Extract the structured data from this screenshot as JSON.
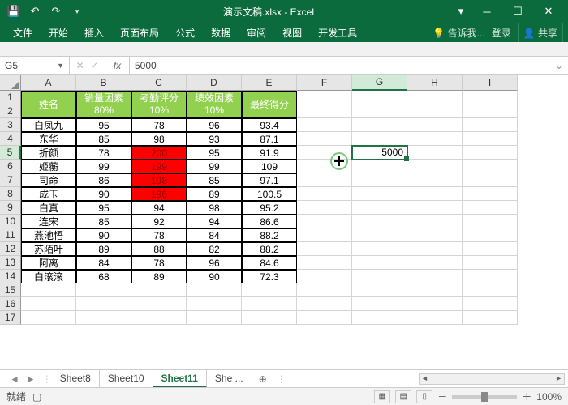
{
  "title": "演示文稿.xlsx - Excel",
  "ribbon": {
    "tabs": [
      "文件",
      "开始",
      "插入",
      "页面布局",
      "公式",
      "数据",
      "审阅",
      "视图",
      "开发工具"
    ],
    "tell": "告诉我...",
    "signin": "登录",
    "share": "共享"
  },
  "namebox": "G5",
  "formula": "5000",
  "columns": [
    "A",
    "B",
    "C",
    "D",
    "E",
    "F",
    "G",
    "H",
    "I"
  ],
  "row_numbers": [
    1,
    2,
    3,
    4,
    5,
    6,
    7,
    8,
    9,
    10,
    11,
    12,
    13,
    14,
    15,
    16,
    17
  ],
  "headers": {
    "name": "姓名",
    "col_b": "销量因素",
    "col_b_sub": "80%",
    "col_c": "考勤评分",
    "col_c_sub": "10%",
    "col_d": "绩效因素",
    "col_d_sub": "10%",
    "col_e": "最终得分"
  },
  "rows": [
    {
      "name": "白凤九",
      "b": 95,
      "c": 78,
      "d": 96,
      "e": 93.4,
      "red": false
    },
    {
      "name": "东华",
      "b": 85,
      "c": 98,
      "d": 93,
      "e": 87.1,
      "red": false
    },
    {
      "name": "折颜",
      "b": 78,
      "c": 200,
      "d": 95,
      "e": 91.9,
      "red": true
    },
    {
      "name": "姬蘅",
      "b": 99,
      "c": 199,
      "d": 99,
      "e": 109,
      "red": true
    },
    {
      "name": "司命",
      "b": 86,
      "c": 198,
      "d": 85,
      "e": 97.1,
      "red": true
    },
    {
      "name": "成玉",
      "b": 90,
      "c": 196,
      "d": 89,
      "e": 100.5,
      "red": true
    },
    {
      "name": "白真",
      "b": 95,
      "c": 94,
      "d": 98,
      "e": 95.2,
      "red": false
    },
    {
      "name": "连宋",
      "b": 85,
      "c": 92,
      "d": 94,
      "e": 86.6,
      "red": false
    },
    {
      "name": "燕池悟",
      "b": 90,
      "c": 78,
      "d": 84,
      "e": 88.2,
      "red": false
    },
    {
      "name": "苏陌叶",
      "b": 89,
      "c": 88,
      "d": 82,
      "e": 88.2,
      "red": false
    },
    {
      "name": "阿离",
      "b": 84,
      "c": 78,
      "d": 96,
      "e": 84.6,
      "red": false
    },
    {
      "name": "白滚滚",
      "b": 68,
      "c": 89,
      "d": 90,
      "e": 72.3,
      "red": false
    }
  ],
  "g5_value": "5000",
  "sheets": {
    "list": [
      "Sheet8",
      "Sheet10",
      "Sheet11",
      "She ..."
    ],
    "active": 2
  },
  "status": {
    "ready": "就绪",
    "zoom": "100%"
  },
  "chart_data": {
    "type": "table",
    "title": "最终得分",
    "columns": [
      "姓名",
      "销量因素(80%)",
      "考勤评分(10%)",
      "绩效因素(10%)",
      "最终得分"
    ],
    "rows": [
      [
        "白凤九",
        95,
        78,
        96,
        93.4
      ],
      [
        "东华",
        85,
        98,
        93,
        87.1
      ],
      [
        "折颜",
        78,
        200,
        95,
        91.9
      ],
      [
        "姬蘅",
        99,
        199,
        99,
        109
      ],
      [
        "司命",
        86,
        198,
        85,
        97.1
      ],
      [
        "成玉",
        90,
        196,
        89,
        100.5
      ],
      [
        "白真",
        95,
        94,
        98,
        95.2
      ],
      [
        "连宋",
        85,
        92,
        94,
        86.6
      ],
      [
        "燕池悟",
        90,
        78,
        84,
        88.2
      ],
      [
        "苏陌叶",
        89,
        88,
        82,
        88.2
      ],
      [
        "阿离",
        84,
        78,
        96,
        84.6
      ],
      [
        "白滚滚",
        68,
        89,
        90,
        72.3
      ]
    ]
  }
}
